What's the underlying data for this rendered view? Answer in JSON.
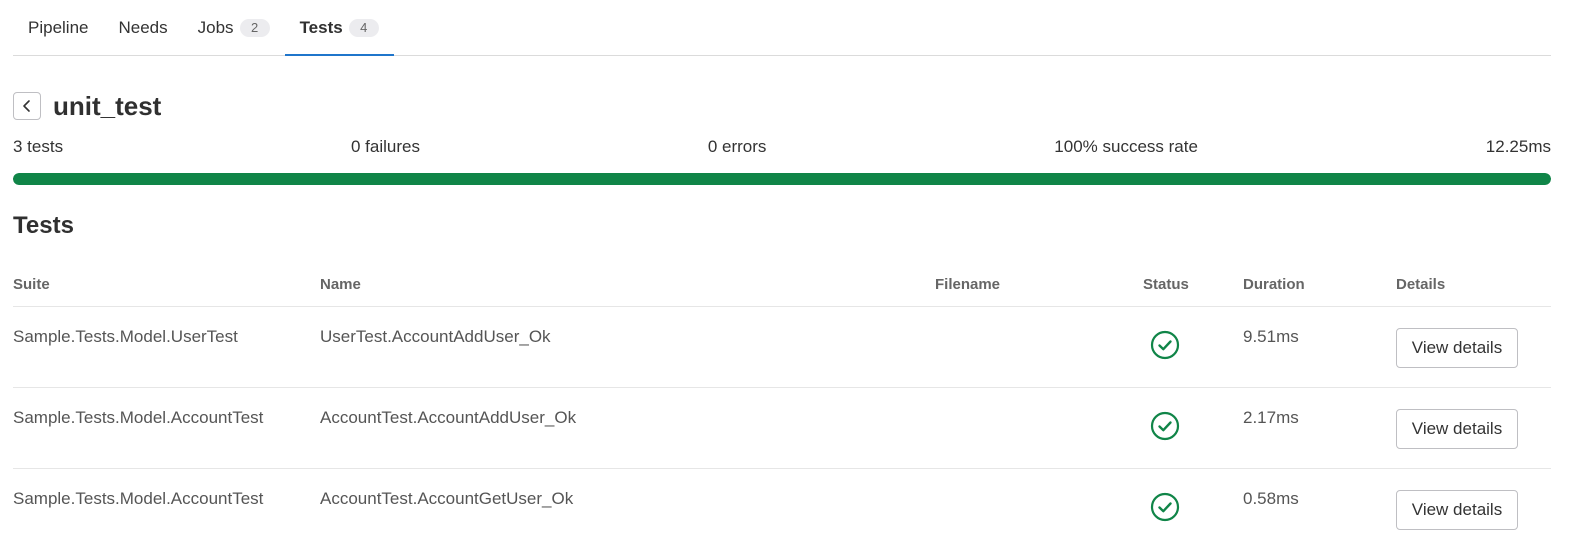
{
  "tabs": [
    {
      "label": "Pipeline",
      "count": null
    },
    {
      "label": "Needs",
      "count": null
    },
    {
      "label": "Jobs",
      "count": "2"
    },
    {
      "label": "Tests",
      "count": "4",
      "active": true
    }
  ],
  "header": {
    "title": "unit_test",
    "back_icon": "chevron-left-icon"
  },
  "summary": {
    "tests": "3 tests",
    "failures": "0 failures",
    "errors": "0 errors",
    "success_rate": "100% success rate",
    "duration": "12.25ms",
    "progress": 1.0,
    "progress_color": "#108548"
  },
  "section": {
    "title": "Tests"
  },
  "table": {
    "headers": {
      "suite": "Suite",
      "name": "Name",
      "filename": "Filename",
      "status": "Status",
      "duration": "Duration",
      "details": "Details"
    },
    "rows": [
      {
        "suite": "Sample.Tests.Model.UserTest",
        "name": "UserTest.AccountAddUser_Ok",
        "filename": "",
        "status": "success",
        "status_icon": "check-circle-icon",
        "duration": "9.51ms",
        "details_label": "View details"
      },
      {
        "suite": "Sample.Tests.Model.AccountTest",
        "name": "AccountTest.AccountAddUser_Ok",
        "filename": "",
        "status": "success",
        "status_icon": "check-circle-icon",
        "duration": "2.17ms",
        "details_label": "View details"
      },
      {
        "suite": "Sample.Tests.Model.AccountTest",
        "name": "AccountTest.AccountGetUser_Ok",
        "filename": "",
        "status": "success",
        "status_icon": "check-circle-icon",
        "duration": "0.58ms",
        "details_label": "View details"
      }
    ]
  },
  "colors": {
    "success": "#108548",
    "tab_active_underline": "#1f75cb"
  }
}
